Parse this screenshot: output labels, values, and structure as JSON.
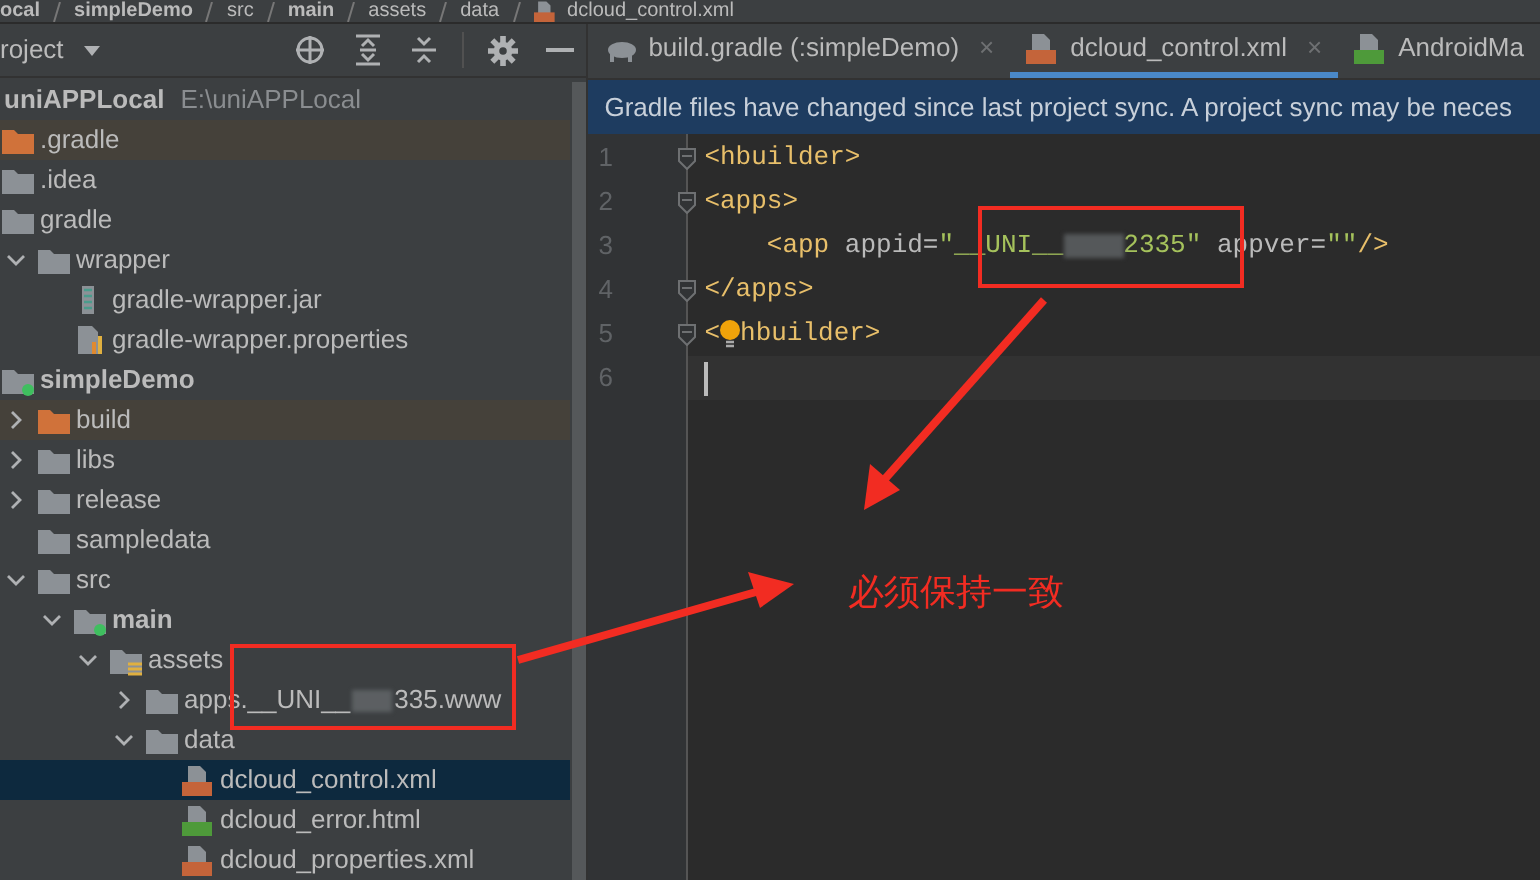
{
  "breadcrumb": [
    {
      "label": "ocal",
      "bold": true
    },
    {
      "label": "simpleDemo",
      "bold": true
    },
    {
      "label": "src",
      "bold": false
    },
    {
      "label": "main",
      "bold": true
    },
    {
      "label": "assets",
      "bold": false
    },
    {
      "label": "data",
      "bold": false
    },
    {
      "label": "dcloud_control.xml",
      "bold": false,
      "kind": "xml"
    }
  ],
  "project_panel": {
    "title": "roject",
    "tree": [
      {
        "label": "uniAPPLocal",
        "hint": "E:\\uniAPPLocal",
        "kind": "folder",
        "bold": true,
        "selected": false,
        "children": [
          {
            "label": ".gradle",
            "kind": "folder",
            "bold": false,
            "selected": false,
            "excluded": true
          },
          {
            "label": ".idea",
            "kind": "folder",
            "bold": false,
            "selected": false,
            "excluded": false
          },
          {
            "label": "gradle",
            "kind": "folder",
            "bold": false,
            "selected": false,
            "excluded": false,
            "children": [
              {
                "label": "wrapper",
                "kind": "folder",
                "bold": false,
                "selected": false,
                "excluded": false,
                "expanded": true,
                "children": [
                  {
                    "label": "gradle-wrapper.jar",
                    "kind": "jar",
                    "bold": false,
                    "selected": false,
                    "excluded": false
                  },
                  {
                    "label": "gradle-wrapper.properties",
                    "kind": "properties",
                    "bold": false,
                    "selected": false,
                    "excluded": false
                  }
                ]
              }
            ]
          },
          {
            "label": "simpleDemo",
            "kind": "module",
            "bold": true,
            "selected": false,
            "excluded": false,
            "children": [
              {
                "label": "build",
                "kind": "folder",
                "bold": false,
                "selected": false,
                "excluded": true,
                "expanded": false
              },
              {
                "label": "libs",
                "kind": "folder",
                "bold": false,
                "selected": false,
                "excluded": false,
                "expanded": false
              },
              {
                "label": "release",
                "kind": "folder",
                "bold": false,
                "selected": false,
                "excluded": false,
                "expanded": false
              },
              {
                "label": "sampledata",
                "kind": "folder",
                "bold": false,
                "selected": false,
                "excluded": false
              },
              {
                "label": "src",
                "kind": "folder",
                "bold": false,
                "selected": false,
                "excluded": false,
                "expanded": true,
                "children": [
                  {
                    "label": "main",
                    "kind": "source",
                    "bold": true,
                    "selected": false,
                    "excluded": false,
                    "expanded": true,
                    "children": [
                      {
                        "label": "assets",
                        "kind": "resources",
                        "bold": false,
                        "selected": false,
                        "excluded": false,
                        "expanded": true,
                        "children": [
                          {
                            "label": "apps.__UNI__",
                            "label_end": "335.www",
                            "redacted": true,
                            "kind": "folder",
                            "bold": false,
                            "selected": false,
                            "excluded": false,
                            "expanded": false
                          },
                          {
                            "label": "data",
                            "kind": "folder",
                            "bold": false,
                            "selected": false,
                            "excluded": false,
                            "expanded": true,
                            "children": [
                              {
                                "label": "dcloud_control.xml",
                                "kind": "xml",
                                "bold": false,
                                "selected": true,
                                "excluded": false
                              },
                              {
                                "label": "dcloud_error.html",
                                "kind": "html",
                                "bold": false,
                                "selected": false,
                                "excluded": false
                              },
                              {
                                "label": "dcloud_properties.xml",
                                "kind": "xml",
                                "bold": false,
                                "selected": false,
                                "excluded": false
                              }
                            ]
                          }
                        ]
                      }
                    ]
                  }
                ]
              }
            ]
          }
        ]
      }
    ]
  },
  "tabs": [
    {
      "label": "build.gradle (:simpleDemo)",
      "kind": "gradle",
      "selected": false,
      "close": "×"
    },
    {
      "label": "dcloud_control.xml",
      "kind": "xml",
      "selected": true,
      "close": "×"
    },
    {
      "label": "AndroidMa",
      "kind": "manifest",
      "selected": false
    }
  ],
  "notification": "Gradle files have changed since last project sync. A project sync may be neces",
  "editor": {
    "lines": [
      {
        "number": "1",
        "fold": true,
        "current": false,
        "segments": [
          {
            "kind": "tag",
            "text": "<hbuilder>"
          }
        ]
      },
      {
        "number": "2",
        "fold": true,
        "current": false,
        "segments": [
          {
            "kind": "tag",
            "text": "<apps>"
          }
        ]
      },
      {
        "number": "3",
        "fold": false,
        "current": false,
        "segments": [
          {
            "kind": "tag",
            "text": "    <app "
          },
          {
            "kind": "attr",
            "text": "appid="
          },
          {
            "kind": "value",
            "text": "\"__UNI__"
          },
          {
            "kind": "redacted"
          },
          {
            "kind": "value",
            "text": "2335\""
          },
          {
            "kind": "attr",
            "text": " appver="
          },
          {
            "kind": "value",
            "text": "\"\""
          },
          {
            "kind": "tag",
            "text": "/>"
          }
        ]
      },
      {
        "number": "4",
        "fold": true,
        "current": false,
        "segments": [
          {
            "kind": "tag",
            "text": "</apps>"
          }
        ]
      },
      {
        "number": "5",
        "fold": true,
        "current": false,
        "segments": [
          {
            "kind": "tag",
            "text": "<"
          },
          {
            "kind": "bulb"
          },
          {
            "kind": "tag",
            "text": "hbuilder>"
          }
        ]
      },
      {
        "number": "6",
        "fold": false,
        "current": true
      }
    ]
  },
  "annotation": {
    "text": "必须保持一致"
  }
}
